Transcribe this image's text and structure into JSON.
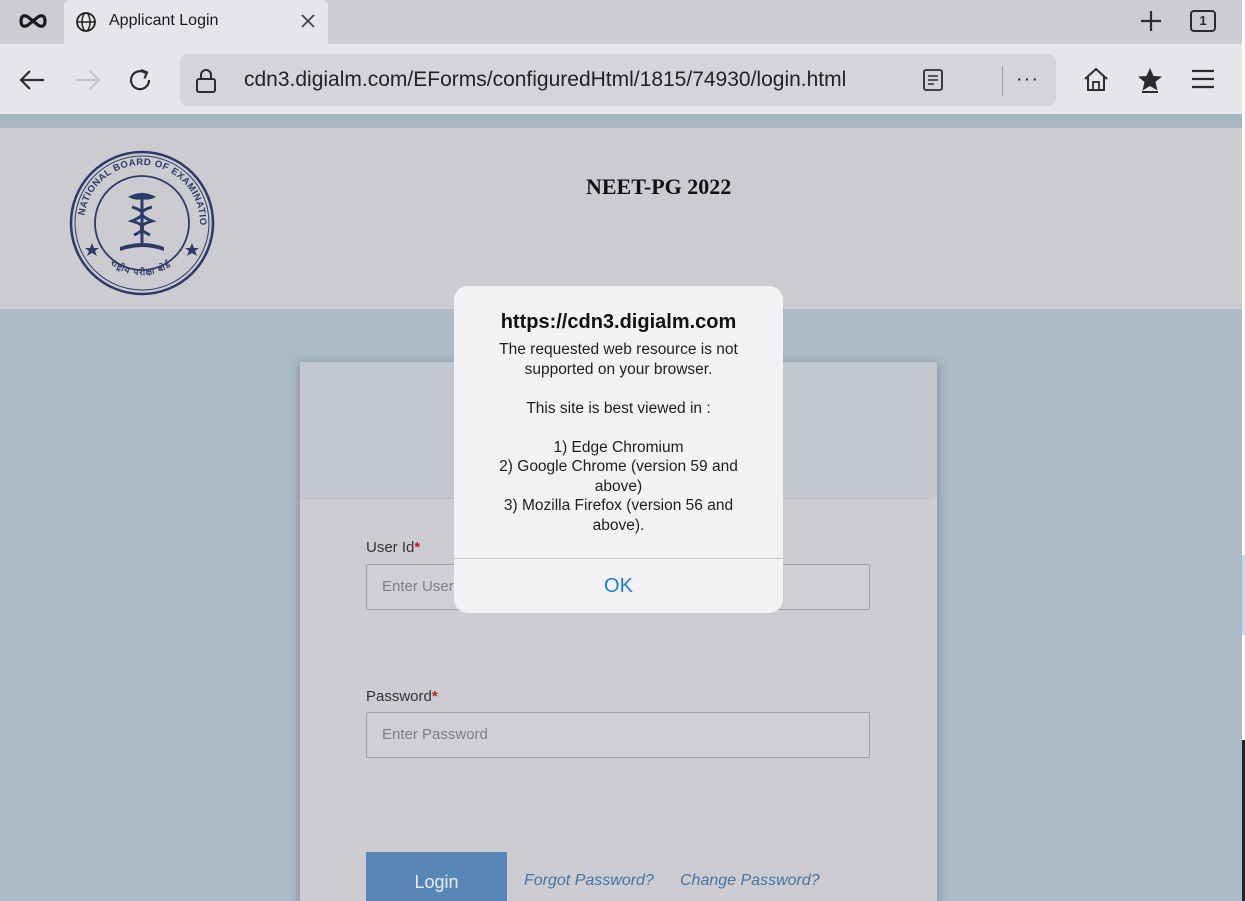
{
  "browser": {
    "tab": {
      "title": "Applicant Login"
    },
    "tab_count": "1",
    "url": "cdn3.digialm.com/EForms/configuredHtml/1815/74930/login.html",
    "more_label": "···"
  },
  "page": {
    "exam_title": "NEET-PG 2022",
    "emblem_alt": "NATIONAL BOARD OF EXAMINATIONS IN MEDICAL SCIENCES",
    "login": {
      "user_id_label": "User Id",
      "user_id_placeholder": "Enter User Id",
      "password_label": "Password",
      "password_placeholder": "Enter Password",
      "required_mark": "*",
      "login_button": "Login",
      "forgot_password": "Forgot Password?",
      "change_password": "Change Password?"
    }
  },
  "dialog": {
    "title": "https://cdn3.digialm.com",
    "message": "The requested web resource is not supported on your browser.\n\nThis site is best viewed in :\n\n1) Edge Chromium\n2) Google Chrome (version 59 and above)\n3) Mozilla Firefox (version 56 and above).",
    "ok_label": "OK"
  },
  "colors": {
    "accent": "#1f7be0",
    "login_button": "#5886b7",
    "required": "#c0202a",
    "emblem": "#2b3a68"
  }
}
